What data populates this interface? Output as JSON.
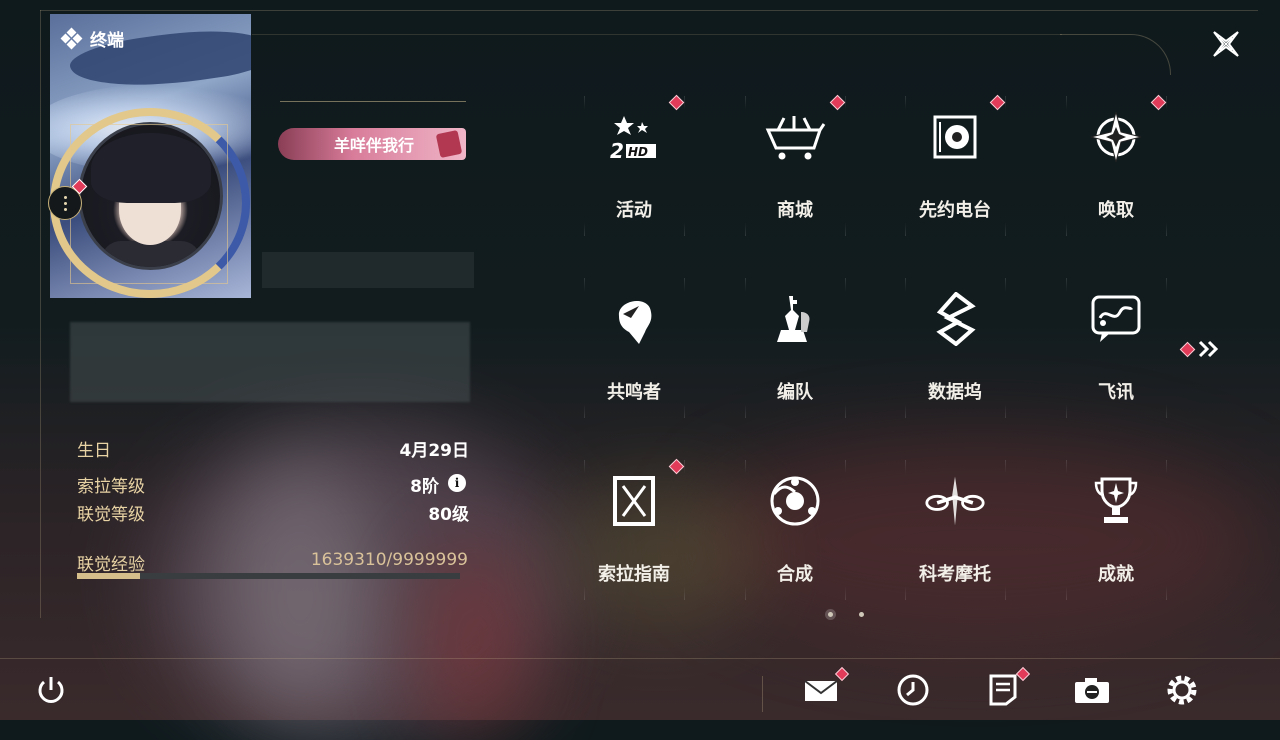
{
  "header": {
    "section_title": "终端",
    "close_icon": "close-x-icon"
  },
  "profile": {
    "title_badge": "羊咩伴我行",
    "birthday_label": "生日",
    "birthday_value": "4月29日",
    "sola_level_label": "索拉等级",
    "sola_level_value": "8阶",
    "union_level_label": "联觉等级",
    "union_level_value": "80级",
    "exp_label": "联觉经验",
    "exp_value": "1639310/9999999",
    "exp_progress": 0.1639
  },
  "menu": {
    "items": [
      {
        "label": "活动",
        "icon": "event-2nd-icon",
        "badge": true
      },
      {
        "label": "商城",
        "icon": "shop-basket-icon",
        "badge": true
      },
      {
        "label": "先约电台",
        "icon": "radio-icon",
        "badge": true
      },
      {
        "label": "唤取",
        "icon": "convene-star-icon",
        "badge": true
      },
      {
        "label": "共鸣者",
        "icon": "resonator-head-icon",
        "badge": false
      },
      {
        "label": "编队",
        "icon": "team-chess-icon",
        "badge": false
      },
      {
        "label": "数据坞",
        "icon": "data-bank-icon",
        "badge": false
      },
      {
        "label": "飞讯",
        "icon": "message-chat-icon",
        "badge": false
      },
      {
        "label": "索拉指南",
        "icon": "guidebook-icon",
        "badge": true
      },
      {
        "label": "合成",
        "icon": "synthesis-icon",
        "badge": false
      },
      {
        "label": "科考摩托",
        "icon": "motorbike-icon",
        "badge": false
      },
      {
        "label": "成就",
        "icon": "trophy-icon",
        "badge": false
      }
    ],
    "page_count": 2,
    "current_page": 1
  },
  "bottom_bar": {
    "icons": [
      "power-icon",
      "mail-icon",
      "clock-icon",
      "notes-icon",
      "camera-icon",
      "gear-icon"
    ]
  },
  "colors": {
    "accent_gold": "#e8d3a4",
    "badge_red": "#e23b5a",
    "title_pink": "#d87c9a"
  }
}
